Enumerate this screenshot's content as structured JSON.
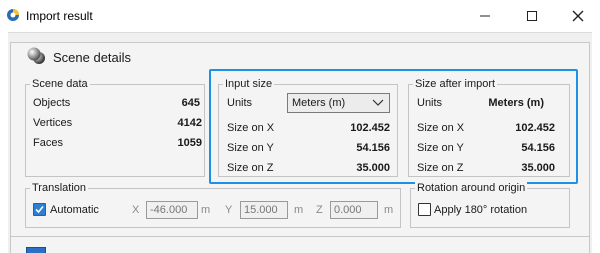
{
  "window": {
    "title": "Import result"
  },
  "header": {
    "title": "Scene details"
  },
  "scene_data": {
    "title": "Scene data",
    "rows": [
      {
        "label": "Objects",
        "value": "645"
      },
      {
        "label": "Vertices",
        "value": "4142"
      },
      {
        "label": "Faces",
        "value": "1059"
      }
    ]
  },
  "input_size": {
    "title": "Input size",
    "units_label": "Units",
    "units_value": "Meters (m)",
    "rows": [
      {
        "label": "Size on X",
        "value": "102.452"
      },
      {
        "label": "Size on Y",
        "value": "54.156"
      },
      {
        "label": "Size on Z",
        "value": "35.000"
      }
    ]
  },
  "size_after": {
    "title": "Size after import",
    "units_label": "Units",
    "units_value": "Meters (m)",
    "rows": [
      {
        "label": "Size on X",
        "value": "102.452"
      },
      {
        "label": "Size on Y",
        "value": "54.156"
      },
      {
        "label": "Size on Z",
        "value": "35.000"
      }
    ]
  },
  "translation": {
    "title": "Translation",
    "automatic_label": "Automatic",
    "automatic_checked": true,
    "x_label": "X",
    "x_value": "-46.000",
    "x_unit": "m",
    "y_label": "Y",
    "y_value": "15.000",
    "y_unit": "m",
    "z_label": "Z",
    "z_value": "0.000",
    "z_unit": "m"
  },
  "rotation": {
    "title": "Rotation around origin",
    "apply_label": "Apply 180° rotation",
    "apply_checked": false
  },
  "colors": {
    "highlight": "#1e90e6",
    "checkbox": "#2b7fd4"
  }
}
